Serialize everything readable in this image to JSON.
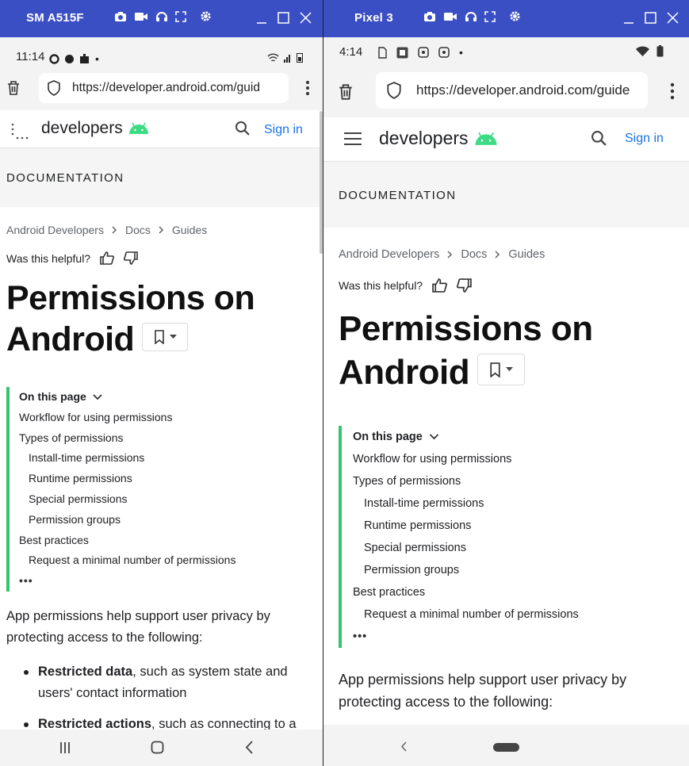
{
  "left": {
    "window_title": "SM A515F",
    "status_time": "11:14",
    "url": "https://developer.android.com/guid",
    "brand": "developers",
    "sign_in": "Sign in",
    "section_label": "DOCUMENTATION",
    "breadcrumb": [
      "Android Developers",
      "Docs",
      "Guides"
    ],
    "helpful": "Was this helpful?",
    "title_line1": "Permissions on",
    "title_line2": "Android",
    "toc_heading": "On this page",
    "toc": [
      {
        "label": "Workflow for using permissions",
        "level": 1
      },
      {
        "label": "Types of permissions",
        "level": 1
      },
      {
        "label": "Install-time permissions",
        "level": 2
      },
      {
        "label": "Runtime permissions",
        "level": 2
      },
      {
        "label": "Special permissions",
        "level": 2
      },
      {
        "label": "Permission groups",
        "level": 2
      },
      {
        "label": "Best practices",
        "level": 1
      },
      {
        "label": "Request a minimal number of permissions",
        "level": 2
      }
    ],
    "toc_more": "•••",
    "intro": "App permissions help support user privacy by protecting access to the following:",
    "bullets": [
      {
        "bold": "Restricted data",
        "rest": ", such as system state and users' contact information"
      },
      {
        "bold": "Restricted actions",
        "rest": ", such as connecting to a"
      }
    ]
  },
  "right": {
    "window_title": "Pixel 3",
    "status_time": "4:14",
    "url": "https://developer.android.com/guide",
    "brand": "developers",
    "sign_in": "Sign in",
    "section_label": "DOCUMENTATION",
    "breadcrumb": [
      "Android Developers",
      "Docs",
      "Guides"
    ],
    "helpful": "Was this helpful?",
    "title_line1": "Permissions on",
    "title_line2": "Android",
    "toc_heading": "On this page",
    "toc": [
      {
        "label": "Workflow for using permissions",
        "level": 1
      },
      {
        "label": "Types of permissions",
        "level": 1
      },
      {
        "label": "Install-time permissions",
        "level": 2
      },
      {
        "label": "Runtime permissions",
        "level": 2
      },
      {
        "label": "Special permissions",
        "level": 2
      },
      {
        "label": "Permission groups",
        "level": 2
      },
      {
        "label": "Best practices",
        "level": 1
      },
      {
        "label": "Request a minimal number of permissions",
        "level": 2
      }
    ],
    "toc_more": "•••",
    "intro": "App permissions help support user privacy by protecting access to the following:"
  },
  "colors": {
    "titlebar": "#3b4fc4",
    "link": "#1a73e8",
    "toc_accent": "#34c46e",
    "android_green": "#3ddc84"
  },
  "icons": [
    "camera-icon",
    "video-icon",
    "headphones-icon",
    "fullscreen-icon",
    "gear-icon",
    "minimize-icon",
    "maximize-icon",
    "close-icon",
    "trash-icon",
    "shield-icon",
    "more-vert-icon",
    "menu-icon",
    "android-logo-icon",
    "search-icon",
    "thumb-up-icon",
    "thumb-down-icon",
    "bookmark-icon",
    "chevron-down-icon",
    "chevron-right-icon",
    "back-icon",
    "home-icon",
    "recents-icon"
  ]
}
